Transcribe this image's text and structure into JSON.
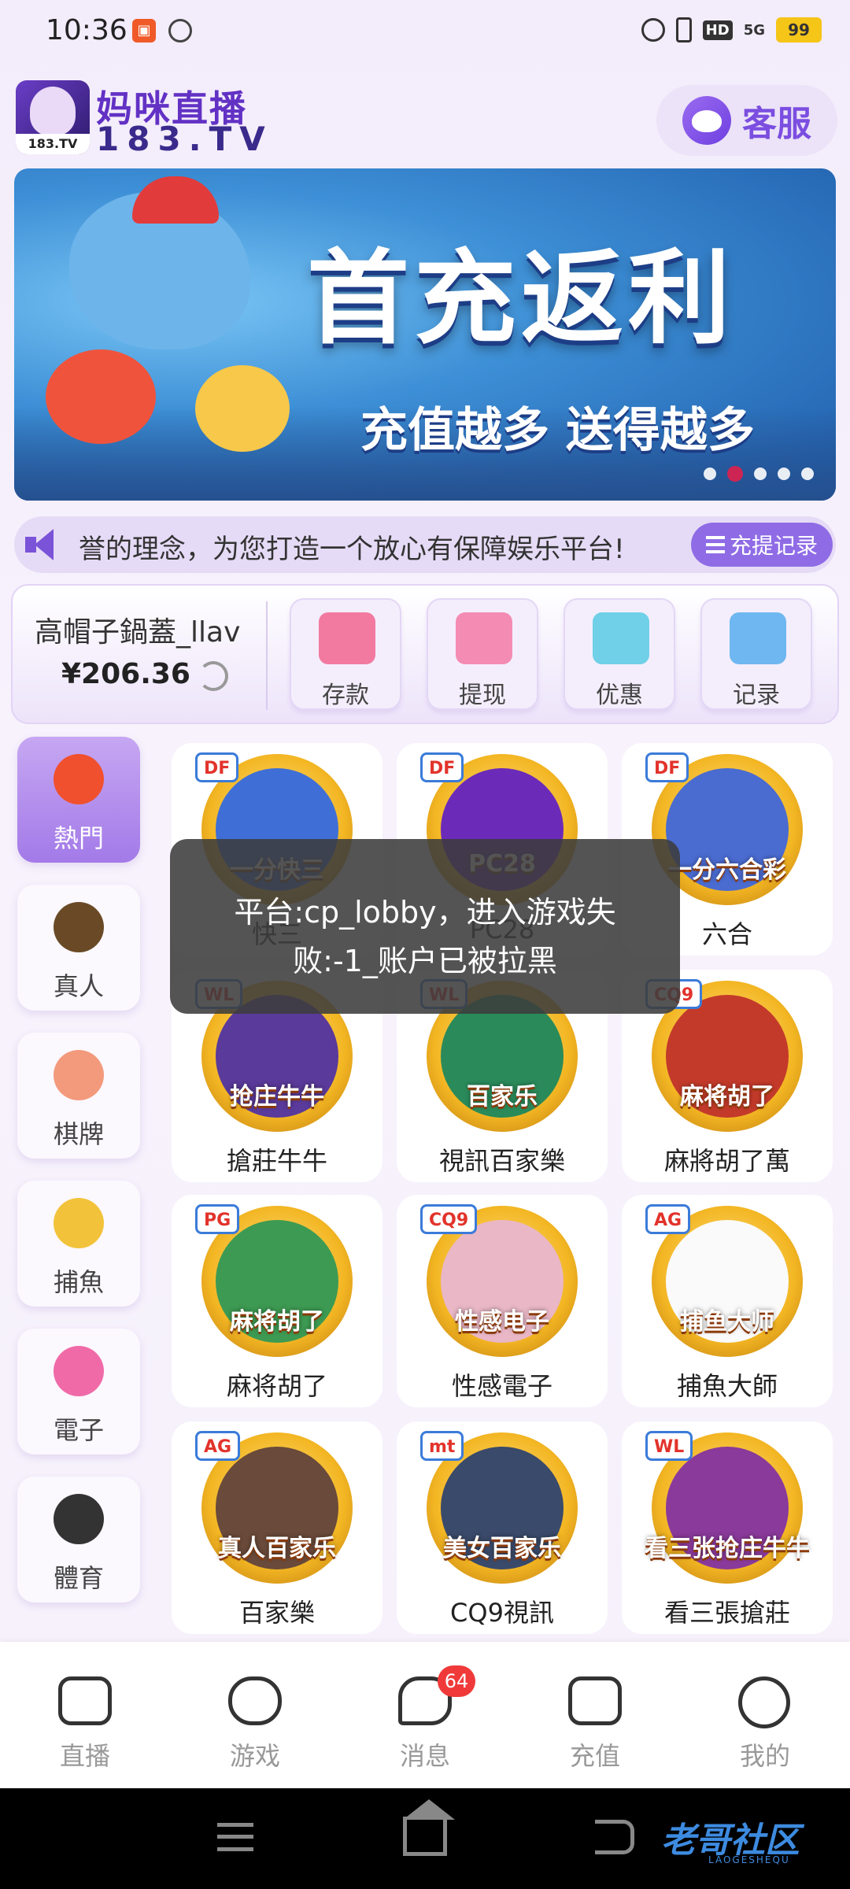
{
  "status_bar": {
    "time": "10:36",
    "network": "5G",
    "hd": "HD",
    "battery": "99"
  },
  "header": {
    "logo_title": "妈咪直播",
    "logo_sub": "183.TV",
    "logo_tag": "183.TV",
    "service_label": "客服"
  },
  "banner": {
    "title": "首充返利",
    "subtitle": "充值越多 送得越多",
    "slide_count": 5,
    "active_slide": 1
  },
  "notice": {
    "text": "誉的理念，为您打造一个放心有保障娱乐平台!",
    "records_label": "充提记录"
  },
  "wallet": {
    "username": "高帽子鍋蓋_llav",
    "balance": "¥206.36",
    "actions": [
      {
        "label": "存款",
        "icon": "card-icon",
        "color": "#f27aa0"
      },
      {
        "label": "提现",
        "icon": "money-bag-icon",
        "color": "#f48bb3"
      },
      {
        "label": "优惠",
        "icon": "gift-icon",
        "color": "#6fd0e8"
      },
      {
        "label": "记录",
        "icon": "bar-chart-icon",
        "color": "#6fb7f0"
      }
    ]
  },
  "categories": [
    {
      "label": "熱門",
      "icon": "fire-icon",
      "color": "#f0502d",
      "active": true
    },
    {
      "label": "真人",
      "icon": "chip-icon",
      "color": "#6a4a26",
      "active": false
    },
    {
      "label": "棋牌",
      "icon": "card-game-icon",
      "color": "#f39a7c",
      "active": false
    },
    {
      "label": "捕魚",
      "icon": "fish-icon",
      "color": "#f2c33a",
      "active": false
    },
    {
      "label": "電子",
      "icon": "slot-icon",
      "color": "#f06aa8",
      "active": false
    },
    {
      "label": "體育",
      "icon": "soccer-ball-icon",
      "color": "#333333",
      "active": false
    }
  ],
  "games": [
    {
      "name": "快三",
      "badge": "DF",
      "medal_text": "一分快三",
      "inner": "#3f6fd6"
    },
    {
      "name": "PC28",
      "badge": "DF",
      "medal_text": "PC28",
      "inner": "#6b2bb8"
    },
    {
      "name": "六合",
      "badge": "DF",
      "medal_text": "一分六合彩",
      "inner": "#4a6bd0"
    },
    {
      "name": "搶莊牛牛",
      "badge": "WL",
      "medal_text": "抢庄牛牛",
      "inner": "#5a3a9a"
    },
    {
      "name": "視訊百家樂",
      "badge": "WL",
      "medal_text": "百家乐",
      "inner": "#2a8a5a"
    },
    {
      "name": "麻將胡了萬",
      "badge": "CQ9",
      "medal_text": "麻将胡了",
      "inner": "#c43a2a"
    },
    {
      "name": "麻将胡了",
      "badge": "PG",
      "medal_text": "麻将胡了",
      "inner": "#3d9a52"
    },
    {
      "name": "性感電子",
      "badge": "CQ9",
      "medal_text": "性感电子",
      "inner": "#e9b7c6"
    },
    {
      "name": "捕魚大師",
      "badge": "AG",
      "medal_text": "捕鱼大师",
      "inner": "#fafafa"
    },
    {
      "name": "百家樂",
      "badge": "AG",
      "medal_text": "真人百家乐",
      "inner": "#6a4a3a"
    },
    {
      "name": "CQ9視訊",
      "badge": "mt",
      "medal_text": "美女百家乐",
      "inner": "#3a4a6a"
    },
    {
      "name": "看三張搶莊",
      "badge": "WL",
      "medal_text": "看三张抢庄牛牛",
      "inner": "#8a3a9a"
    }
  ],
  "toast": {
    "line1": "平台:cp_lobby，进入游戏失",
    "line2": "败:-1_账户已被拉黑"
  },
  "tabbar": {
    "items": [
      {
        "label": "直播",
        "icon": "tv-icon"
      },
      {
        "label": "游戏",
        "icon": "gamepad-icon"
      },
      {
        "label": "消息",
        "icon": "message-icon",
        "badge": "64"
      },
      {
        "label": "充值",
        "icon": "wallet-icon"
      },
      {
        "label": "我的",
        "icon": "profile-icon"
      }
    ]
  },
  "navbar": {
    "watermark": "老哥社区",
    "watermark_sub": "LAOGESHEQU"
  }
}
